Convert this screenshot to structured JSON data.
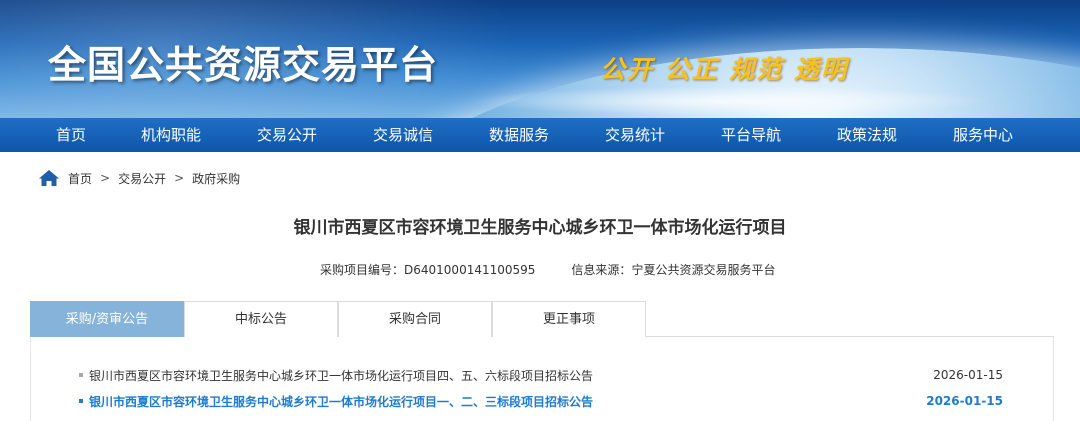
{
  "header": {
    "site_title": "全国公共资源交易平台",
    "slogan": "公开 公正 规范 透明"
  },
  "nav": {
    "items": [
      "首页",
      "机构职能",
      "交易公开",
      "交易诚信",
      "数据服务",
      "交易统计",
      "平台导航",
      "政策法规",
      "服务中心"
    ]
  },
  "breadcrumb": {
    "items": [
      "首页",
      "交易公开",
      "政府采购"
    ],
    "separator": ">"
  },
  "project": {
    "title": "银川市西夏区市容环境卫生服务中心城乡环卫一体市场化运行项目",
    "code_label": "采购项目编号：",
    "code_value": "D6401000141100595",
    "source_label": "信息来源：",
    "source_value": "宁夏公共资源交易服务平台"
  },
  "tabs": {
    "items": [
      "采购/资审公告",
      "中标公告",
      "采购合同",
      "更正事项"
    ],
    "active": 0
  },
  "announcements": [
    {
      "title": "银川市西夏区市容环境卫生服务中心城乡环卫一体市场化运行项目四、五、六标段项目招标公告",
      "date": "2026-01-15"
    },
    {
      "title": "银川市西夏区市容环境卫生服务中心城乡环卫一体市场化运行项目一、二、三标段项目招标公告",
      "date": "2026-01-15"
    }
  ],
  "colors": {
    "nav_blue": "#0d56aa",
    "active_tab": "#86b3d9",
    "link_blue": "#1e7bd0",
    "slogan_gold": "#f7c21c"
  }
}
